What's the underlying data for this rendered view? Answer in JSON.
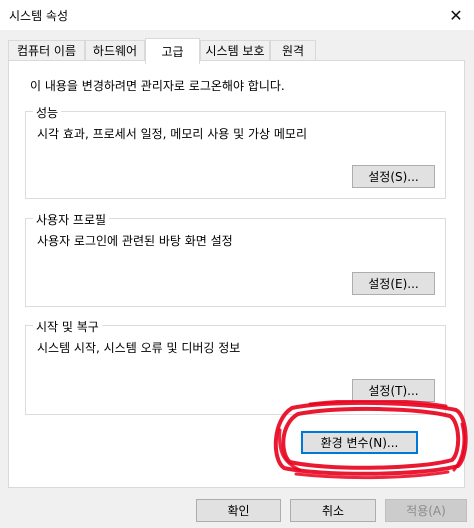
{
  "window": {
    "title": "시스템 속성",
    "close_glyph": "✕"
  },
  "tabs": [
    {
      "label": "컴퓨터 이름"
    },
    {
      "label": "하드웨어"
    },
    {
      "label": "고급"
    },
    {
      "label": "시스템 보호"
    },
    {
      "label": "원격"
    }
  ],
  "active_tab": "고급",
  "notice": "이 내용을 변경하려면 관리자로 로그온해야 합니다.",
  "groups": {
    "performance": {
      "label": "성능",
      "desc": "시각 효과, 프로세서 일정, 메모리 사용 및 가상 메모리",
      "button": "설정(S)..."
    },
    "profiles": {
      "label": "사용자 프로필",
      "desc": "사용자 로그인에 관련된 바탕 화면 설정",
      "button": "설정(E)..."
    },
    "startup": {
      "label": "시작 및 복구",
      "desc": "시스템 시작, 시스템 오류 및 디버깅 정보",
      "button": "설정(T)..."
    }
  },
  "env_button": "환경 변수(N)...",
  "footer": {
    "ok": "확인",
    "cancel": "취소",
    "apply": "적용(A)"
  },
  "colors": {
    "focus": "#0078d7",
    "scribble": "#e8001c"
  }
}
